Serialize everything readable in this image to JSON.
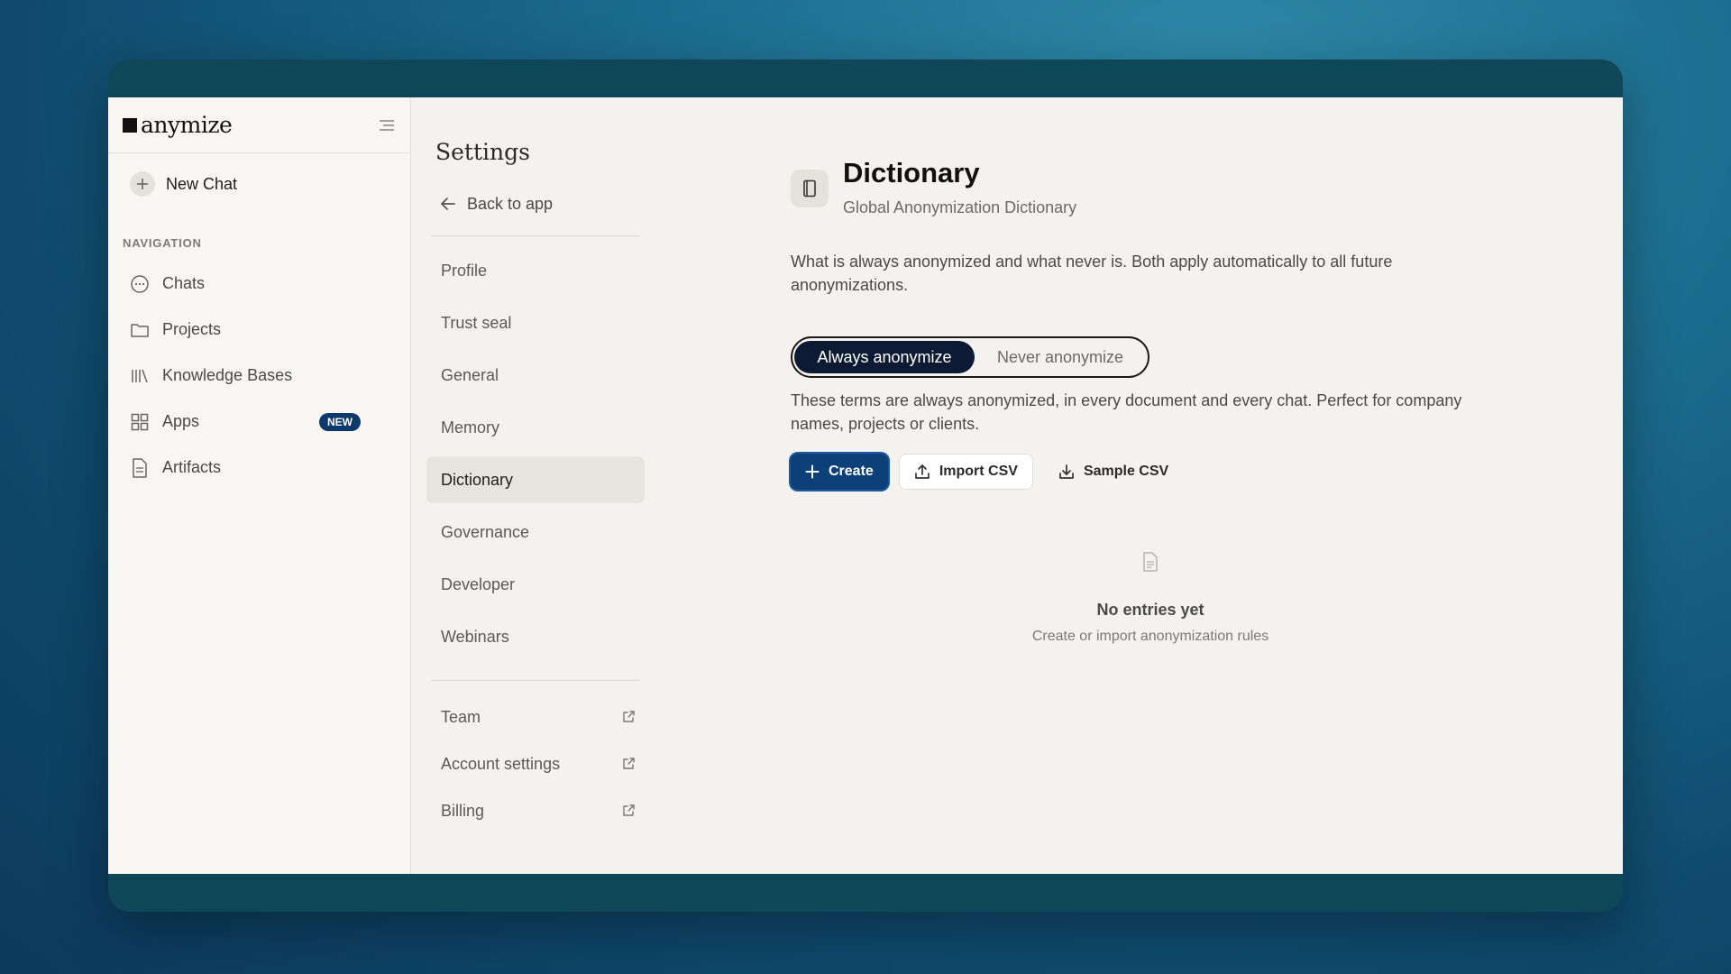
{
  "app": {
    "logo_text": "anymize"
  },
  "sidebar": {
    "new_chat_label": "New Chat",
    "nav_title": "NAVIGATION",
    "items": [
      {
        "label": "Chats",
        "icon": "chat-bubble-icon"
      },
      {
        "label": "Projects",
        "icon": "folder-icon"
      },
      {
        "label": "Knowledge Bases",
        "icon": "library-icon"
      },
      {
        "label": "Apps",
        "icon": "grid-icon",
        "badge": "NEW"
      },
      {
        "label": "Artifacts",
        "icon": "document-icon"
      }
    ]
  },
  "settings": {
    "title": "Settings",
    "back_label": "Back to app",
    "menu": [
      "Profile",
      "Trust seal",
      "General",
      "Memory",
      "Dictionary",
      "Governance",
      "Developer",
      "Webinars"
    ],
    "active": "Dictionary",
    "external": [
      "Team",
      "Account settings",
      "Billing"
    ]
  },
  "main": {
    "title": "Dictionary",
    "subtitle": "Global Anonymization Dictionary",
    "description": "What is always anonymized and what never is. Both apply automatically to all future anonymizations.",
    "toggle": {
      "on": "Always anonymize",
      "off": "Never anonymize"
    },
    "toggle_description": "These terms are always anonymized, in every document and every chat. Perfect for company names, projects or clients.",
    "buttons": {
      "create": "Create",
      "import": "Import CSV",
      "sample": "Sample CSV"
    },
    "empty": {
      "title": "No entries yet",
      "subtitle": "Create or import anonymization rules"
    }
  },
  "colors": {
    "primary": "#0d3f78",
    "badge": "#0d3a6b",
    "toggle_on": "#0c1b33"
  }
}
